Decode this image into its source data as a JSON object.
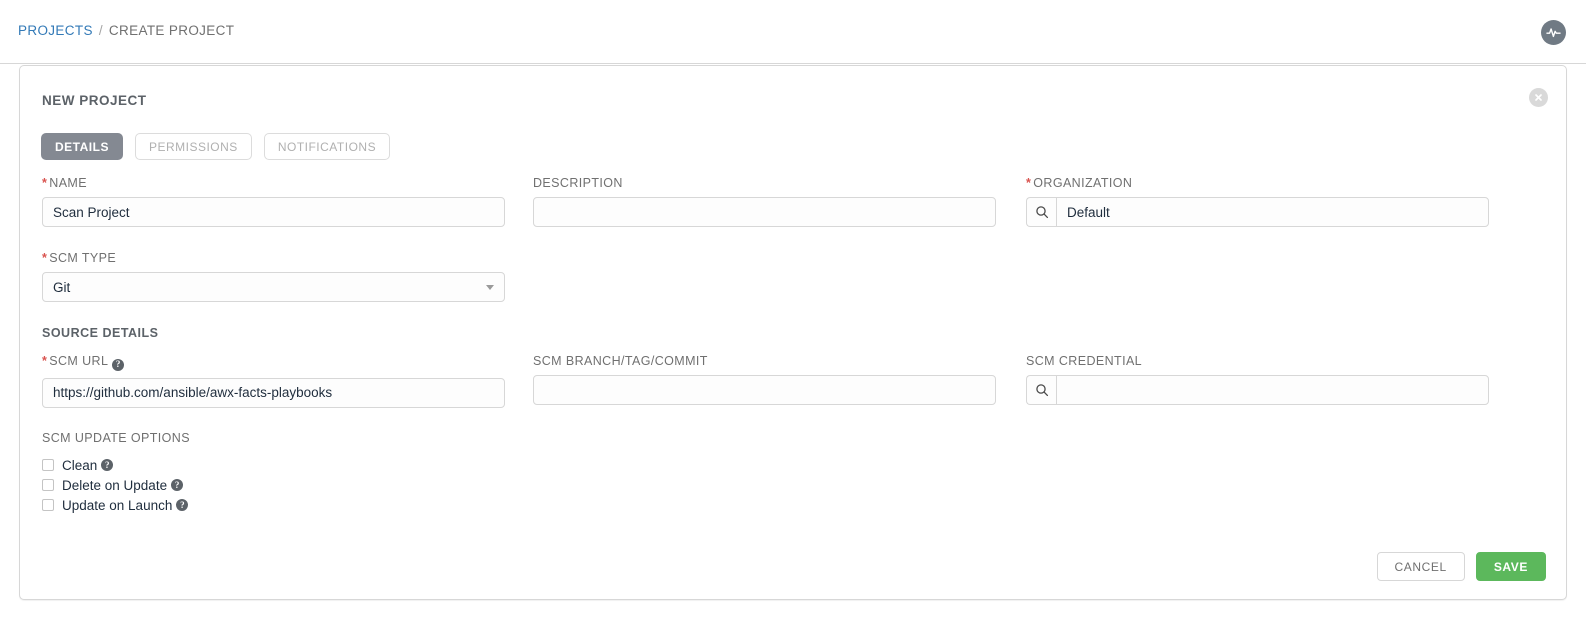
{
  "header": {
    "breadcrumb": {
      "root_label": "PROJECTS",
      "separator": "/",
      "current_label": "CREATE PROJECT"
    },
    "activity_icon": "activity-stream-icon"
  },
  "panel": {
    "title": "NEW PROJECT",
    "close_icon": "close-icon",
    "tabs": [
      {
        "label": "DETAILS",
        "active": true
      },
      {
        "label": "PERMISSIONS",
        "active": false
      },
      {
        "label": "NOTIFICATIONS",
        "active": false
      }
    ]
  },
  "form": {
    "name": {
      "label": "NAME",
      "required": true,
      "value": "Scan Project",
      "placeholder": ""
    },
    "description": {
      "label": "DESCRIPTION",
      "required": false,
      "value": "",
      "placeholder": ""
    },
    "organization": {
      "label": "ORGANIZATION",
      "required": true,
      "value": "Default",
      "placeholder": "",
      "lookup_icon": "search-icon"
    },
    "scm_type": {
      "label": "SCM TYPE",
      "required": true,
      "value": "Git",
      "caret_icon": "chevron-down-icon",
      "options": [
        "Git"
      ]
    },
    "source_details": {
      "heading": "SOURCE DETAILS"
    },
    "scm_url": {
      "label": "SCM URL",
      "required": true,
      "value": "https://github.com/ansible/awx-facts-playbooks",
      "placeholder": "",
      "help_icon": "help-icon",
      "help_glyph": "?"
    },
    "scm_branch": {
      "label": "SCM BRANCH/TAG/COMMIT",
      "required": false,
      "value": "",
      "placeholder": ""
    },
    "scm_credential": {
      "label": "SCM CREDENTIAL",
      "required": false,
      "value": "",
      "placeholder": "",
      "lookup_icon": "search-icon"
    },
    "scm_update_options": {
      "heading": "SCM UPDATE OPTIONS",
      "items": [
        {
          "label": "Clean",
          "checked": false,
          "help_glyph": "?"
        },
        {
          "label": "Delete on Update",
          "checked": false,
          "help_glyph": "?"
        },
        {
          "label": "Update on Launch",
          "checked": false,
          "help_glyph": "?"
        }
      ]
    }
  },
  "footer": {
    "cancel_label": "CANCEL",
    "save_label": "SAVE"
  },
  "colors": {
    "accent_link": "#337ab7",
    "required_star": "#d9534f",
    "tab_active_bg": "#848992",
    "save_green": "#5cb85c",
    "border": "#d7d7d7",
    "label_text": "#707070"
  }
}
